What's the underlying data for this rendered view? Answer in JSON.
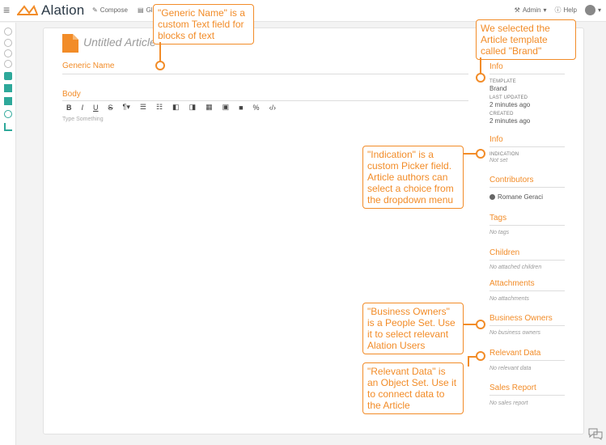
{
  "topbar": {
    "logo_text": "Alation",
    "nav": [
      {
        "label": "Compose",
        "icon": "pencil-icon"
      },
      {
        "label": "Gl",
        "icon": "book-icon"
      }
    ],
    "search_icon": "search-icon",
    "admin_label": "Admin",
    "help_label": "Help"
  },
  "article": {
    "title": "Untitled Article",
    "generic_name_label": "Generic Name",
    "body_label": "Body",
    "toolbar": [
      "B",
      "I",
      "U",
      "S",
      "¶▾",
      "☰",
      "☷",
      "◧",
      "◨",
      "▦",
      "▣",
      "■",
      "%",
      "‹/›"
    ],
    "placeholder": "Type Something"
  },
  "info": {
    "heading": "Info",
    "template_label": "TEMPLATE",
    "template_value": "Brand",
    "last_updated_label": "LAST UPDATED",
    "last_updated_value": "2 minutes ago",
    "created_label": "CREATED",
    "created_value": "2 minutes ago"
  },
  "info2": {
    "heading": "Info",
    "indication_label": "INDICATION",
    "indication_value": "Not set"
  },
  "contributors": {
    "heading": "Contributors",
    "name": "Romane Geraci"
  },
  "tags": {
    "heading": "Tags",
    "empty": "No tags"
  },
  "children": {
    "heading": "Children",
    "empty": "No attached children"
  },
  "attachments": {
    "heading": "Attachments",
    "empty": "No attachments"
  },
  "business_owners": {
    "heading": "Business Owners",
    "empty": "No business owners"
  },
  "relevant_data": {
    "heading": "Relevant Data",
    "empty": "No relevant data"
  },
  "sales_report": {
    "heading": "Sales Report",
    "empty": "No sales report"
  },
  "callouts": {
    "generic_name": "\"Generic Name\" is a custom Text field for blocks of text",
    "template": "We selected the Article template called \"Brand\"",
    "indication": "\"Indication\" is a custom Picker field. Article authors can select a choice from the dropdown menu",
    "business_owners": "\"Business Owners\" is a People Set. Use it to select relevant Alation Users",
    "relevant_data": "\"Relevant Data\" is an Object Set. Use it to connect data to the Article"
  },
  "colors": {
    "accent": "#f28c28",
    "brand": "#2b3946"
  }
}
